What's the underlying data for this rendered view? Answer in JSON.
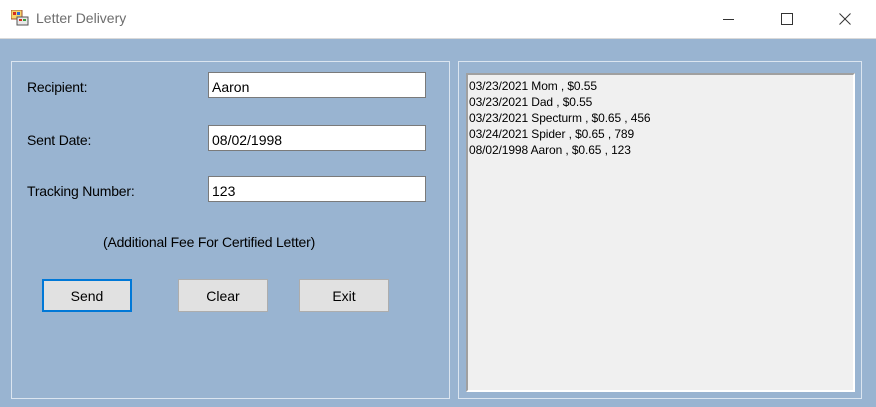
{
  "window": {
    "title": "Letter Delivery",
    "controls": {
      "minimize": "minimize-icon",
      "maximize": "maximize-icon",
      "close": "close-icon"
    }
  },
  "form": {
    "recipient_label": "Recipient:",
    "recipient_value": "Aaron",
    "sent_date_label": "Sent Date:",
    "sent_date_value": "08/02/1998",
    "tracking_label": "Tracking Number:",
    "tracking_value": "123",
    "note": "(Additional Fee For Certified Letter)"
  },
  "buttons": {
    "send": "Send",
    "clear": "Clear",
    "exit": "Exit"
  },
  "listbox": {
    "items": [
      "03/23/2021 Mom , $0.55",
      "03/23/2021 Dad , $0.55",
      "03/23/2021 Specturm , $0.65 , 456",
      "03/24/2021 Spider , $0.65 , 789",
      "08/02/1998 Aaron , $0.65 , 123"
    ]
  },
  "colors": {
    "form_background": "#99b4d1",
    "button_focus_border": "#0078d7"
  }
}
